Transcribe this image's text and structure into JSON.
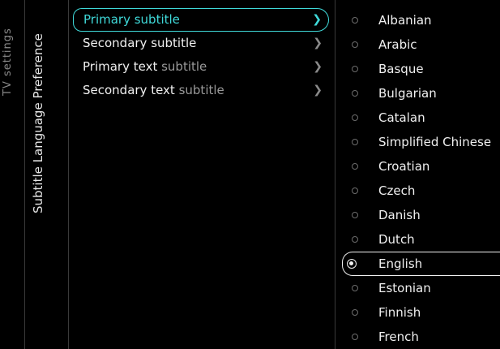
{
  "breadcrumb": {
    "root": "TV settings",
    "current": "Subtitle Language Preference"
  },
  "menu": {
    "items": [
      {
        "label": "Primary subtitle",
        "suffix": "",
        "active": true
      },
      {
        "label": "Secondary subtitle",
        "suffix": "",
        "active": false
      },
      {
        "label": "Primary text ",
        "suffix": "subtitle",
        "active": false
      },
      {
        "label": "Secondary text ",
        "suffix": "subtitle",
        "active": false
      }
    ],
    "chevron_icon": "chevron-right-icon"
  },
  "languages": {
    "items": [
      "Albanian",
      "Arabic",
      "Basque",
      "Bulgarian",
      "Catalan",
      "Simplified Chinese",
      "Croatian",
      "Czech",
      "Danish",
      "Dutch",
      "English",
      "Estonian",
      "Finnish",
      "French"
    ],
    "selected": "English"
  },
  "colors": {
    "accent": "#3fd9d9",
    "background": "#000000"
  }
}
